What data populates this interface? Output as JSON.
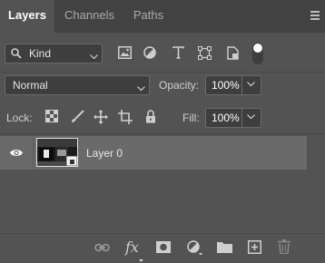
{
  "tabs": [
    {
      "label": "Layers",
      "active": true
    },
    {
      "label": "Channels",
      "active": false
    },
    {
      "label": "Paths",
      "active": false
    }
  ],
  "filter": {
    "kind_label": "Kind",
    "icons": [
      "image-filter-icon",
      "adjustment-filter-icon",
      "type-filter-icon",
      "shape-filter-icon",
      "smart-object-filter-icon"
    ]
  },
  "blend": {
    "mode": "Normal",
    "opacity_label": "Opacity:",
    "opacity_value": "100%"
  },
  "lock": {
    "label": "Lock:",
    "fill_label": "Fill:",
    "fill_value": "100%"
  },
  "layers": [
    {
      "name": "Layer 0",
      "visible": true
    }
  ],
  "bottom": {
    "fx_label": "fx"
  },
  "colors": {
    "panel_bg": "#535353",
    "tabbar_bg": "#424242",
    "selected_layer_bg": "#6a6a6a"
  }
}
